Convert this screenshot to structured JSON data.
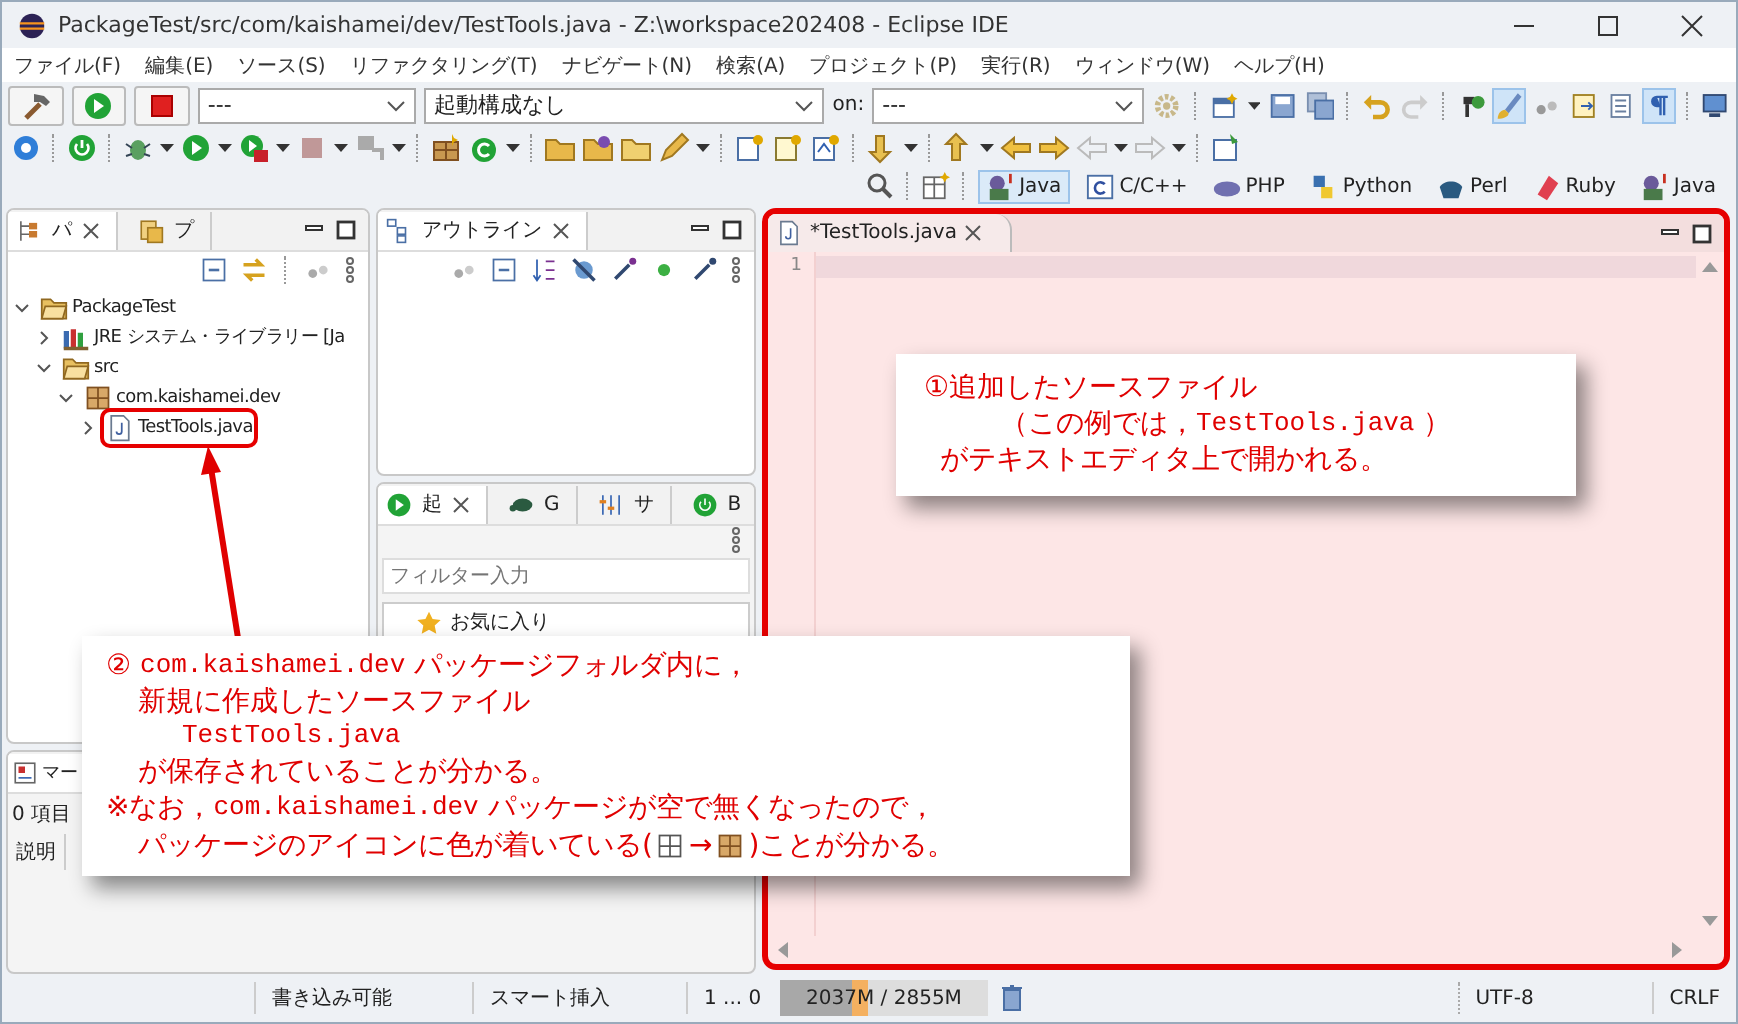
{
  "window": {
    "title": "PackageTest/src/com/kaishamei/dev/TestTools.java - Z:\\workspace202408 - Eclipse IDE"
  },
  "menu": [
    "ファイル(F)",
    "編集(E)",
    "ソース(S)",
    "リファクタリング(T)",
    "ナビゲート(N)",
    "検索(A)",
    "プロジェクト(P)",
    "実行(R)",
    "ウィンドウ(W)",
    "ヘルプ(H)"
  ],
  "toolbar": {
    "mode_combo": "---",
    "launch_combo": "起動構成なし",
    "target_label": "on:",
    "target_combo": "---"
  },
  "perspectives": [
    {
      "label": "Java",
      "selected": true
    },
    {
      "label": "C/C++",
      "selected": false
    },
    {
      "label": "PHP",
      "selected": false
    },
    {
      "label": "Python",
      "selected": false
    },
    {
      "label": "Perl",
      "selected": false
    },
    {
      "label": "Ruby",
      "selected": false
    },
    {
      "label": "Java",
      "selected": false
    }
  ],
  "package_explorer": {
    "tabs": [
      {
        "label": "パ",
        "selected": true
      },
      {
        "label": "プ",
        "selected": false
      }
    ],
    "tree": [
      {
        "label": "PackageTest",
        "kind": "project",
        "expanded": true,
        "highlighted": false,
        "children": [
          {
            "label": "JRE システム・ライブラリー [Ja",
            "kind": "library",
            "expanded": false,
            "highlighted": false
          },
          {
            "label": "src",
            "kind": "folder",
            "expanded": true,
            "highlighted": false,
            "children": [
              {
                "label": "com.kaishamei.dev",
                "kind": "package",
                "expanded": true,
                "highlighted": false,
                "children": [
                  {
                    "label": "TestTools.java",
                    "kind": "java",
                    "expanded": false,
                    "highlighted": true
                  }
                ]
              }
            ]
          }
        ]
      }
    ]
  },
  "outline": {
    "tab": "アウトライン"
  },
  "launch_view": {
    "tabs": [
      {
        "label": "起",
        "selected": true
      },
      {
        "label": "G",
        "selected": false
      },
      {
        "label": "サ",
        "selected": false
      },
      {
        "label": "B",
        "selected": false
      }
    ],
    "filter_placeholder": "フィルター入力",
    "items": [
      "お気に入り"
    ]
  },
  "markers": {
    "tab": "マー",
    "count": "0 項目",
    "column": "説明"
  },
  "editor": {
    "tab": "*TestTools.java",
    "line_numbers": [
      "1"
    ]
  },
  "status_bar": {
    "writable": "書き込み可能",
    "insert_mode": "スマート挿入",
    "position": "1 ... 0",
    "heap": {
      "text": "2037M / 2855M",
      "level": 0.42
    },
    "encoding": "UTF-8",
    "line_delimiter": "CRLF"
  },
  "callouts": [
    {
      "lines": [
        {
          "kind": "lead",
          "parts": [
            {
              "kind": "text",
              "text": "①追加したソースファイル"
            }
          ]
        },
        {
          "kind": "deep",
          "parts": [
            {
              "kind": "text",
              "text": "（この例では，"
            },
            {
              "kind": "code",
              "text": "TestTools.java"
            },
            {
              "kind": "text",
              "text": " ）"
            }
          ]
        },
        {
          "kind": "cont",
          "parts": [
            {
              "kind": "text",
              "text": "がテキストエディタ上で開かれる。"
            }
          ]
        }
      ]
    },
    {
      "lines": [
        {
          "kind": "lead",
          "parts": [
            {
              "kind": "text",
              "text": "② "
            },
            {
              "kind": "code",
              "text": "com.kaishamei.dev"
            },
            {
              "kind": "text",
              "text": " パッケージフォルダ内に，"
            }
          ]
        },
        {
          "kind": "cont",
          "parts": [
            {
              "kind": "text",
              "text": "新規に作成したソースファイル"
            }
          ]
        },
        {
          "kind": "deep",
          "parts": [
            {
              "kind": "code",
              "text": "TestTools.java"
            }
          ]
        },
        {
          "kind": "cont",
          "parts": [
            {
              "kind": "text",
              "text": "が保存されていることが分かる。"
            }
          ]
        },
        {
          "kind": "lead",
          "parts": [
            {
              "kind": "text",
              "text": "※なお，"
            },
            {
              "kind": "code",
              "text": "com.kaishamei.dev"
            },
            {
              "kind": "text",
              "text": " パッケージが空で無くなったので，"
            }
          ]
        },
        {
          "kind": "cont",
          "parts": [
            {
              "kind": "text",
              "text": "パッケージのアイコンに色が着いている("
            },
            {
              "kind": "pkg",
              "colored": false
            },
            {
              "kind": "text",
              "text": "→"
            },
            {
              "kind": "pkg",
              "colored": true
            },
            {
              "kind": "text",
              "text": ")ことが分かる。"
            }
          ]
        }
      ]
    }
  ]
}
